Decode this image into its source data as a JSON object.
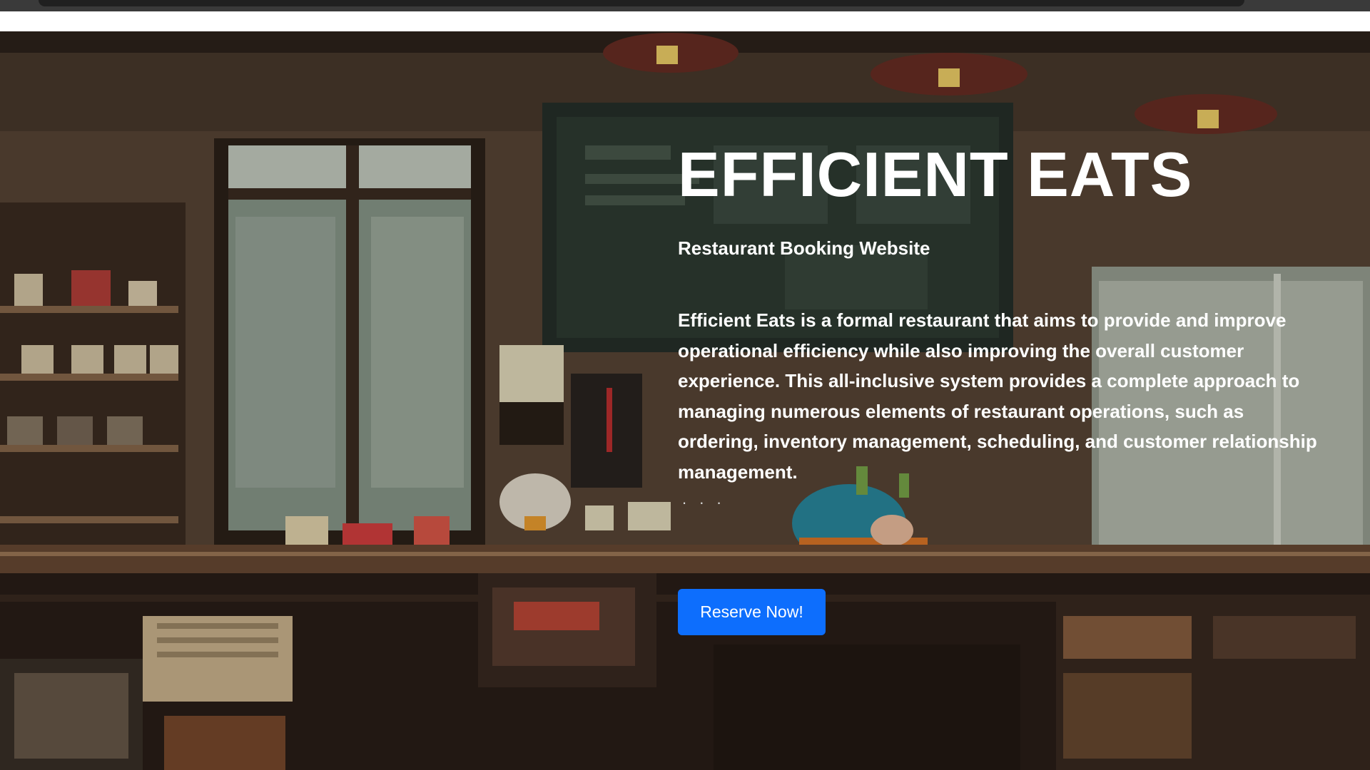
{
  "hero": {
    "title": "EFFICIENT EATS",
    "subtitle": "Restaurant Booking Website",
    "description": "Efficient Eats is a formal restaurant that aims to provide and improve operational efficiency while also improving the overall customer experience. This all-inclusive system provides a complete approach to managing numerous elements of restaurant operations, such as ordering, inventory management, scheduling, and customer relationship management.",
    "ellipsis": ". . .",
    "cta_label": "Reserve Now!"
  },
  "colors": {
    "accent": "#0d6efd",
    "text": "#ffffff"
  }
}
